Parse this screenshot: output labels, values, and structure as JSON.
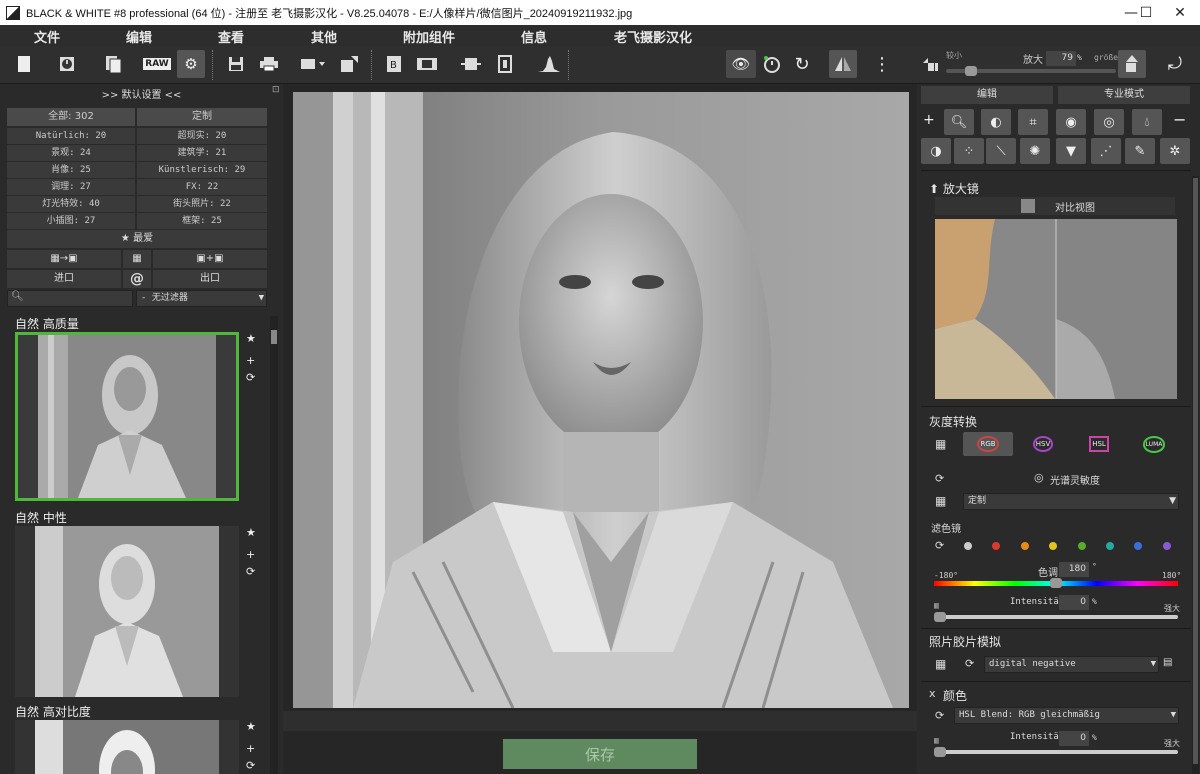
{
  "window": {
    "title": "BLACK & WHITE #8 professional (64 位) - 注册至 老飞摄影汉化 - V8.25.04078 - E:/人像样片/微信图片_20240919211932.jpg",
    "minimize": "—",
    "maximize": "☐",
    "close": "✕"
  },
  "menu": [
    "文件",
    "编辑",
    "查看",
    "其他",
    "附加组件",
    "信息",
    "老飞摄影汉化"
  ],
  "toolbar": {
    "zoom_small_label": "较小",
    "zoom_label": "放大",
    "zoom_value": "79",
    "zoom_unit": "%",
    "zoom_big_label": "größer",
    "zoom_level": 0.79,
    "raw_label": "RAW"
  },
  "left": {
    "header": ">> 默认设置 <<",
    "all_label": "全部: 302",
    "custom_label": "定制",
    "categories": [
      [
        "Natürlich: 20",
        "超现实: 20"
      ],
      [
        "景观: 24",
        "建筑学: 21"
      ],
      [
        "肖像: 25",
        "Künstlerisch: 29"
      ],
      [
        "调理: 27",
        "FX: 22"
      ],
      [
        "灯光特效: 40",
        "街头照片: 22"
      ],
      [
        "小插图: 27",
        "框架: 25"
      ]
    ],
    "favorites": "★ 最爱",
    "import": "进口",
    "at": "@",
    "export": "出口",
    "filter": "- 无过滤器",
    "presets": [
      "自然  高质量",
      "自然  中性",
      "自然  高对比度"
    ]
  },
  "center": {
    "save": "保存"
  },
  "right": {
    "tab_edit": "编辑",
    "tab_pro": "专业模式",
    "magnifier_title": "放大镜",
    "compare_label": "对比视图",
    "gray_title": "灰度转换",
    "modes": [
      "RGB",
      "HSV",
      "HSL",
      "LUMA"
    ],
    "spectral": "光谱灵敏度",
    "preset_select": "定制",
    "filter_label": "滤色镜",
    "filter_colors": [
      "#cccccc",
      "#d93a2b",
      "#e58a1c",
      "#e5c11c",
      "#5aaa2c",
      "#22a9a0",
      "#3a6fd6",
      "#8a5ad6"
    ],
    "hue_label": "色调",
    "hue_value": "180",
    "hue_unit": "°",
    "hue_min": "-180°",
    "hue_max": "180°",
    "intensity_label": "Intensität",
    "intensity_value": "0",
    "intensity_unit": "%",
    "intensity_level": 0,
    "big_label": "强大",
    "film_title": "照片胶片模拟",
    "film_select": "digital negative",
    "color_title": "颜色",
    "color_close": "x",
    "color_select": "HSL Blend: RGB gleichmäßig",
    "intensity2_label": "Intensität",
    "intensity2_value": "0",
    "intensity2_unit": "%",
    "intensity2_level": 0,
    "big2_label": "强大"
  }
}
